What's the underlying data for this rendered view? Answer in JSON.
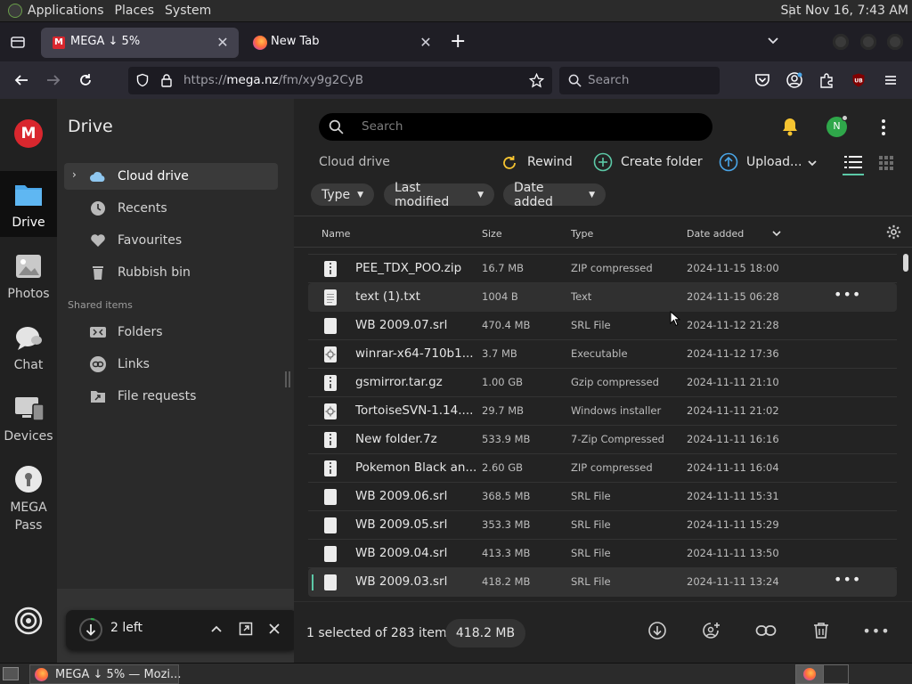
{
  "panel": {
    "menus": [
      "Applications",
      "Places",
      "System"
    ],
    "clock": "Sat Nov 16,  7:43 AM"
  },
  "browser": {
    "tabs": [
      {
        "label": "MEGA ↓ 5%",
        "close": "✕"
      },
      {
        "label": "New Tab",
        "close": "✕"
      }
    ],
    "new_tab": "+",
    "url_prefix": "https://",
    "url_host": "mega.nz",
    "url_path": "/fm/xy9g2CyB",
    "search_placeholder": "Search"
  },
  "rail": {
    "items": [
      {
        "label": "Drive"
      },
      {
        "label": "Photos"
      },
      {
        "label": "Chat"
      },
      {
        "label": "Devices"
      },
      {
        "label": "MEGA\nPass"
      }
    ]
  },
  "sidebar": {
    "title": "Drive",
    "items": [
      "Cloud drive",
      "Recents",
      "Favourites",
      "Rubbish bin"
    ],
    "shared_heading": "Shared items",
    "shared_items": [
      "Folders",
      "Links",
      "File requests"
    ]
  },
  "transfer": {
    "label": "2 left"
  },
  "main": {
    "search_placeholder": "Search",
    "avatar_initial": "N",
    "breadcrumb": "Cloud drive",
    "actions": [
      "Rewind",
      "Create folder",
      "Upload..."
    ],
    "filters": [
      "Type",
      "Last modified",
      "Date added"
    ],
    "columns": [
      "Name",
      "Size",
      "Type",
      "Date added"
    ],
    "rows": [
      {
        "name": "PEE_TDX_POO.zip",
        "size": "16.7 MB",
        "type": "ZIP compressed",
        "date": "2024-11-15 18:00",
        "icon": "zip"
      },
      {
        "name": "text (1).txt",
        "size": "1004 B",
        "type": "Text",
        "date": "2024-11-15 06:28",
        "icon": "text"
      },
      {
        "name": "WB 2009.07.srl",
        "size": "470.4 MB",
        "type": "SRL File",
        "date": "2024-11-12 21:28",
        "icon": "blank"
      },
      {
        "name": "winrar-x64-710b1...",
        "size": "3.7 MB",
        "type": "Executable",
        "date": "2024-11-12 17:36",
        "icon": "exec"
      },
      {
        "name": "gsmirror.tar.gz",
        "size": "1.00 GB",
        "type": "Gzip compressed",
        "date": "2024-11-11 21:10",
        "icon": "zip"
      },
      {
        "name": "TortoiseSVN-1.14....",
        "size": "29.7 MB",
        "type": "Windows installer",
        "date": "2024-11-11 21:02",
        "icon": "exec"
      },
      {
        "name": "New folder.7z",
        "size": "533.9 MB",
        "type": "7-Zip Compressed",
        "date": "2024-11-11 16:16",
        "icon": "zip"
      },
      {
        "name": "Pokemon Black an...",
        "size": "2.60 GB",
        "type": "ZIP compressed",
        "date": "2024-11-11 16:04",
        "icon": "zip"
      },
      {
        "name": "WB 2009.06.srl",
        "size": "368.5 MB",
        "type": "SRL File",
        "date": "2024-11-11 15:31",
        "icon": "blank"
      },
      {
        "name": "WB 2009.05.srl",
        "size": "353.3 MB",
        "type": "SRL File",
        "date": "2024-11-11 15:29",
        "icon": "blank"
      },
      {
        "name": "WB 2009.04.srl",
        "size": "413.3 MB",
        "type": "SRL File",
        "date": "2024-11-11 13:50",
        "icon": "blank"
      },
      {
        "name": "WB 2009.03.srl",
        "size": "418.2 MB",
        "type": "SRL File",
        "date": "2024-11-11 13:24",
        "icon": "blank"
      }
    ],
    "selection_text": "1 selected of 283 items",
    "selection_size": "418.2 MB"
  },
  "taskbar": {
    "window_label": "MEGA ↓ 5% — Mozi..."
  },
  "colors": {
    "mega_red": "#d9272e",
    "accent_blue": "#4aa6e8",
    "online_green": "#2fa74a",
    "bell": "#f6c431"
  }
}
